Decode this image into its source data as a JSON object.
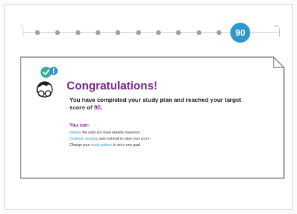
{
  "progress": {
    "min_label": "0",
    "max_label": "100",
    "current_score": "90",
    "dot_count": 11
  },
  "card": {
    "title": "Congratulations!",
    "subtitle_prefix": "You have completed your study plan and reached your target score of ",
    "subtitle_score": "90",
    "subtitle_suffix": ".",
    "you_can": "You can:",
    "line1_link": "Review",
    "line1_text": " the units you have already mastered.",
    "line2_link": "Continue studying",
    "line2_text": " new material to raise your score.",
    "line3_prefix": "Change your ",
    "line3_link": "study options",
    "line3_suffix": " to set a new goal."
  },
  "colors": {
    "accent_purple": "#7b2a8d",
    "link_blue": "#2f96d0",
    "badge_teal": "#3aa9a0"
  },
  "icons": {
    "avatar": "student-glasses-icon",
    "check": "check-badge-icon",
    "alert": "exclamation-badge-icon"
  }
}
